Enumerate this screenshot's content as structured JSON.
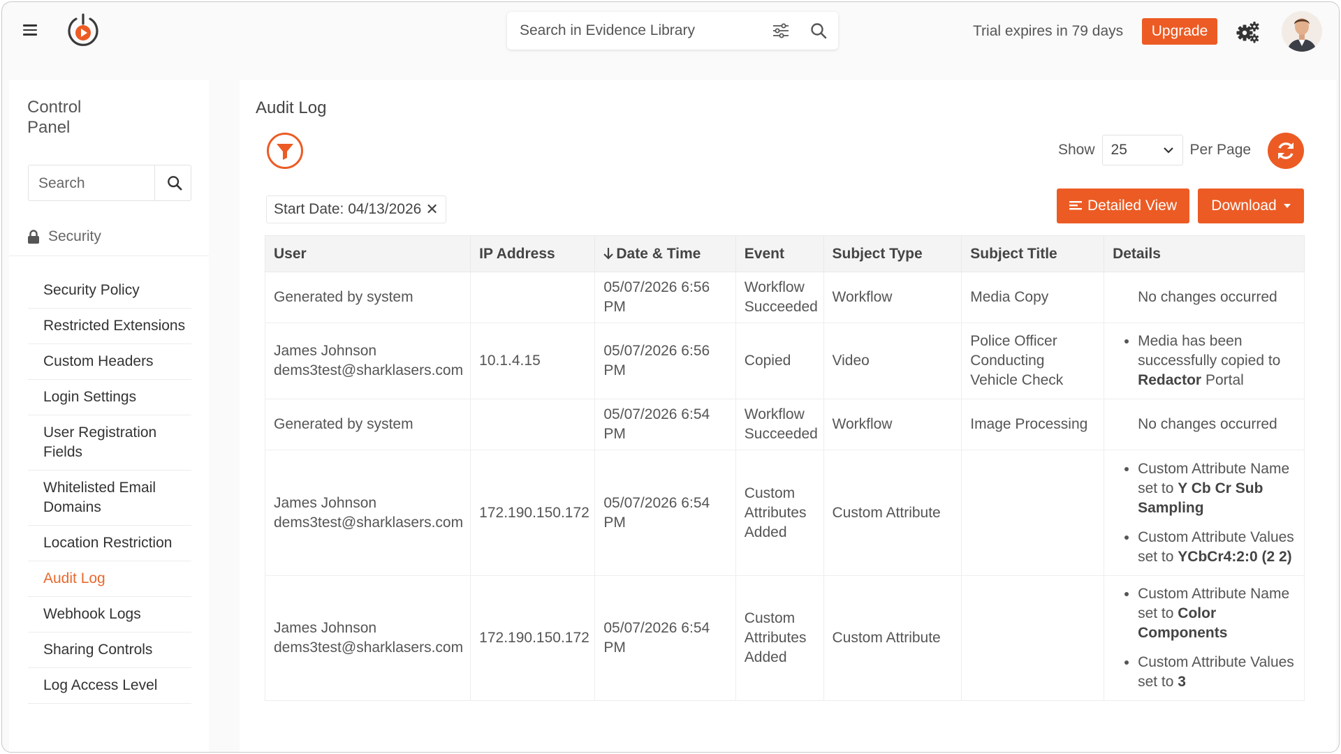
{
  "header": {
    "search_placeholder": "Search in Evidence Library",
    "trial_text": "Trial expires in 79 days",
    "upgrade_label": "Upgrade"
  },
  "sidebar": {
    "title": "Control Panel",
    "search_placeholder": "Search",
    "section": "Security",
    "items": [
      {
        "label": "Security Policy"
      },
      {
        "label": "Restricted Extensions"
      },
      {
        "label": "Custom Headers"
      },
      {
        "label": "Login Settings"
      },
      {
        "label": "User Registration Fields"
      },
      {
        "label": "Whitelisted Email Domains"
      },
      {
        "label": "Location Restriction"
      },
      {
        "label": "Audit Log",
        "active": true
      },
      {
        "label": "Webhook Logs"
      },
      {
        "label": "Sharing Controls"
      },
      {
        "label": "Log Access Level"
      }
    ]
  },
  "main": {
    "title": "Audit Log",
    "show_label": "Show",
    "per_page_value": "25",
    "per_page_label": "Per Page",
    "filter_chip": "Start Date: 04/13/2026",
    "detailed_view_label": "Detailed View",
    "download_label": "Download",
    "columns": [
      "User",
      "IP Address",
      "Date & Time",
      "Event",
      "Subject Type",
      "Subject Title",
      "Details"
    ],
    "rows": [
      {
        "user": "Generated by system",
        "email": "",
        "ip": "",
        "datetime": "05/07/2026 6:56 PM",
        "event": "Workflow Succeeded",
        "subject_type": "Workflow",
        "subject_title": "Media Copy",
        "details_text": "No changes occurred"
      },
      {
        "user": "James Johnson",
        "email": "dems3test@sharklasers.com",
        "ip": "10.1.4.15",
        "datetime": "05/07/2026 6:56 PM",
        "event": "Copied",
        "subject_type": "Video",
        "subject_title": "Police Officer Conducting Vehicle Check",
        "details": [
          {
            "text": "Media has been successfully copied to",
            "bold": "Redactor",
            "suffix": " Portal"
          }
        ]
      },
      {
        "user": "Generated by system",
        "email": "",
        "ip": "",
        "datetime": "05/07/2026 6:54 PM",
        "event": "Workflow Succeeded",
        "subject_type": "Workflow",
        "subject_title": "Image Processing",
        "details_text": "No changes occurred"
      },
      {
        "user": "James Johnson",
        "email": "dems3test@sharklasers.com",
        "ip": "172.190.150.172",
        "datetime": "05/07/2026 6:54 PM",
        "event": "Custom Attributes Added",
        "subject_type": "Custom Attribute",
        "subject_title": "",
        "details": [
          {
            "text": "Custom Attribute Name set to",
            "bold": "Y Cb Cr Sub Sampling",
            "suffix": ""
          },
          {
            "text": "Custom Attribute Values set to",
            "bold": "YCbCr4:2:0 (2 2)",
            "suffix": ""
          }
        ]
      },
      {
        "user": "James Johnson",
        "email": "dems3test@sharklasers.com",
        "ip": "172.190.150.172",
        "datetime": "05/07/2026 6:54 PM",
        "event": "Custom Attributes Added",
        "subject_type": "Custom Attribute",
        "subject_title": "",
        "details": [
          {
            "text": "Custom Attribute Name set to",
            "bold": "Color Components",
            "suffix": ""
          },
          {
            "text": "Custom Attribute Values set to",
            "bold": "3",
            "suffix": ""
          }
        ]
      }
    ]
  },
  "colors": {
    "accent": "#ec5b24",
    "active_link": "#e8692e"
  },
  "icons": [
    "hamburger-icon",
    "logo",
    "filter-sliders-icon",
    "search-icon",
    "gears-icon",
    "lock-icon",
    "funnel-icon",
    "refresh-icon",
    "list-icon",
    "chevron-down-icon",
    "close-icon",
    "sort-down-icon"
  ]
}
